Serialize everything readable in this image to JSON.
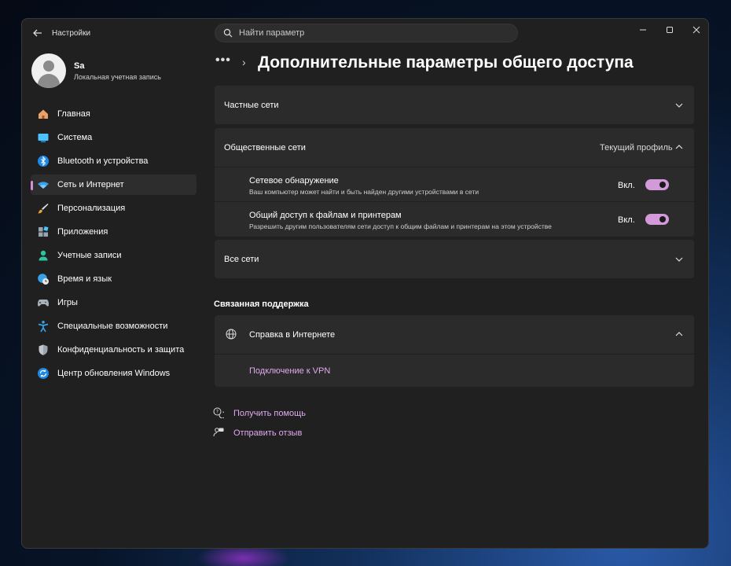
{
  "app": {
    "title": "Настройки"
  },
  "search": {
    "placeholder": "Найти параметр"
  },
  "user": {
    "name": "Sa",
    "account_type": "Локальная учетная запись"
  },
  "sidebar": {
    "items": [
      {
        "label": "Главная",
        "icon": "home-icon"
      },
      {
        "label": "Система",
        "icon": "display-icon"
      },
      {
        "label": "Bluetooth и устройства",
        "icon": "bluetooth-icon"
      },
      {
        "label": "Сеть и Интернет",
        "icon": "wifi-icon",
        "active": true
      },
      {
        "label": "Персонализация",
        "icon": "brush-icon"
      },
      {
        "label": "Приложения",
        "icon": "apps-icon"
      },
      {
        "label": "Учетные записи",
        "icon": "person-icon"
      },
      {
        "label": "Время и язык",
        "icon": "globe-clock-icon"
      },
      {
        "label": "Игры",
        "icon": "gamepad-icon"
      },
      {
        "label": "Специальные возможности",
        "icon": "accessibility-icon"
      },
      {
        "label": "Конфиденциальность и защита",
        "icon": "shield-icon"
      },
      {
        "label": "Центр обновления Windows",
        "icon": "update-icon"
      }
    ]
  },
  "breadcrumb": {
    "dots": "•••",
    "separator": "›"
  },
  "main": {
    "title": "Дополнительные параметры общего доступа",
    "private": {
      "label": "Частные сети"
    },
    "public": {
      "label": "Общественные сети",
      "note": "Текущий профиль",
      "discovery": {
        "title": "Сетевое обнаружение",
        "desc": "Ваш компьютер может найти и быть найден другими устройствами в сети",
        "state": "Вкл."
      },
      "sharing": {
        "title": "Общий доступ к файлам и принтерам",
        "desc": "Разрешить другим пользователям сети доступ к общим файлам и принтерам на этом устройстве",
        "state": "Вкл."
      }
    },
    "all": {
      "label": "Все сети"
    }
  },
  "support": {
    "title": "Связанная поддержка",
    "help_title": "Справка в Интернете",
    "vpn_link": "Подключение к VPN"
  },
  "footer": {
    "get_help": "Получить помощь",
    "feedback": "Отправить отзыв"
  },
  "colors": {
    "accent": "#d29ad9",
    "link": "#e0aaf0",
    "window_bg": "#202020",
    "card_bg": "#2b2b2b"
  }
}
